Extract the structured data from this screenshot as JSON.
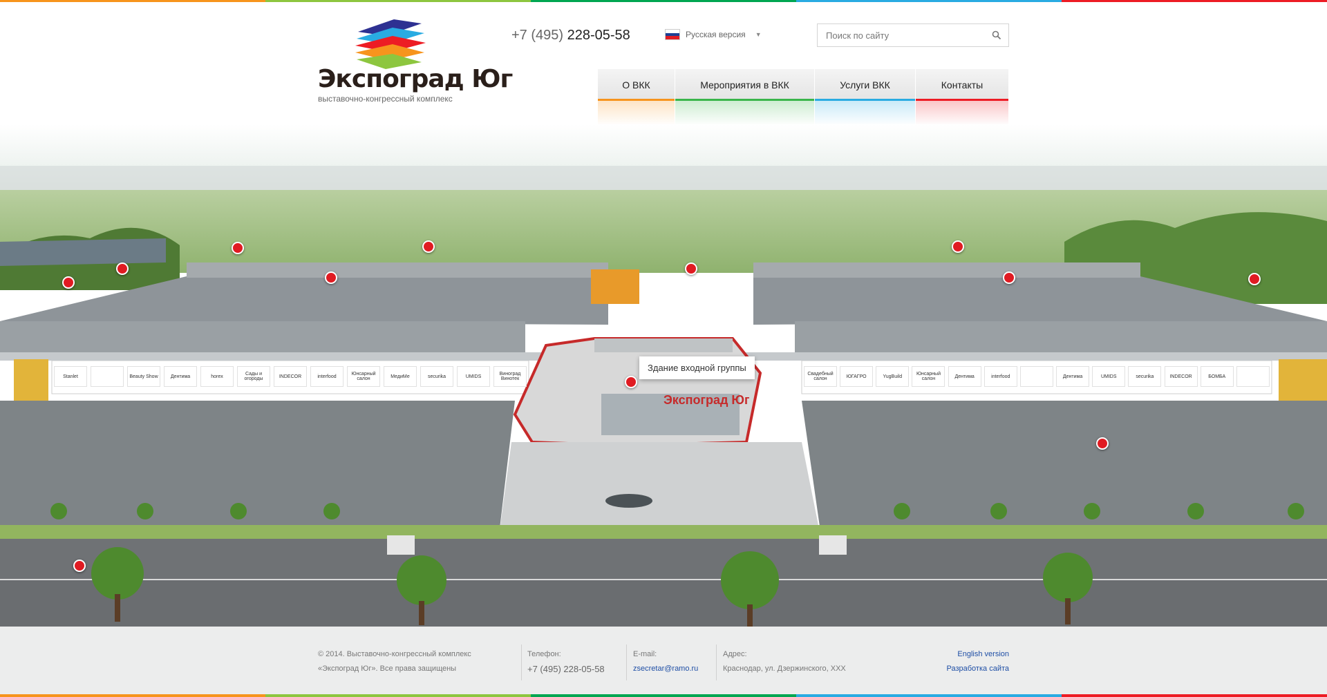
{
  "colors": {
    "stripe": [
      "#f7941d",
      "#8dc63f",
      "#00a651",
      "#29abe2",
      "#ed1c24"
    ],
    "brand_red": "#e01b22"
  },
  "header": {
    "logo": {
      "name": "Экспоград Юг",
      "subtitle": "выставочно-конгрессный комплекс"
    },
    "phone": {
      "code": "+7 (495)",
      "number": "228-05-58"
    },
    "language": {
      "selected": "Русская версия",
      "icon": "russia-flag-icon"
    },
    "search": {
      "placeholder": "Поиск по сайту",
      "icon": "search-icon"
    },
    "nav": [
      {
        "label": "О ВКК",
        "color": "#f7941d"
      },
      {
        "label": "Мероприятия в ВКК",
        "color": "#39b54a"
      },
      {
        "label": "Услуги ВКК",
        "color": "#29abe2"
      },
      {
        "label": "Контакты",
        "color": "#ed1c24"
      }
    ]
  },
  "scene": {
    "building_sign": "Экспоград Юг",
    "tooltip": "Здание входной группы",
    "pin_count": 13,
    "left_banners": [
      "Stanlet",
      "",
      "Beauty Show",
      "Дентима",
      "horex",
      "Сады и огороды",
      "INDECOR",
      "interfood",
      "Юнсарный салон",
      "МедиМе",
      "securika",
      "UMIDS",
      "Виноград Винотек"
    ],
    "right_banners": [
      "Свадебный салон",
      "ЮГАГРО",
      "YugBuild",
      "Юнсарный салон",
      "Дентима",
      "interfood",
      "",
      "Дентима",
      "UMIDS",
      "securika",
      "INDECOR",
      "БОМБА",
      ""
    ]
  },
  "footer": {
    "copyright_line1": "© 2014. Выставочно-конгрессный комплекс",
    "copyright_line2": "«Экспоград Юг». Все права защищены",
    "phone_label": "Телефон:",
    "phone_value": "+7 (495) 228-05-58",
    "email_label": "E-mail:",
    "email_value": "zsecretar@ramo.ru",
    "address_label": "Адрес:",
    "address_value": "Краснодар, ул. Дзержинского, XXX",
    "english_link": "English version",
    "developer_link": "Разработка сайта"
  }
}
